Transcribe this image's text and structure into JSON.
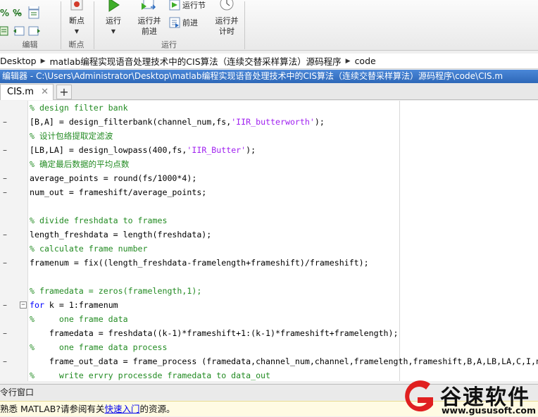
{
  "ribbon": {
    "groups": [
      {
        "label": "编辑"
      },
      {
        "label": "断点"
      },
      {
        "label": "运行"
      }
    ],
    "breakpoints_button": {
      "label": "断点"
    },
    "run_button": {
      "label": "运行"
    },
    "run_advance_button": {
      "label": "运行并\n前进"
    },
    "run_section_button": {
      "label": "运行节"
    },
    "advance_button": {
      "label": "前进"
    },
    "run_time_button": {
      "label": "运行并\n计时"
    }
  },
  "address": {
    "parts": [
      "Desktop",
      "matlab编程实现语音处理技术中的CIS算法（连续交替采样算法）源码程序",
      "code"
    ]
  },
  "editor": {
    "title": "编辑器 - C:\\Users\\Administrator\\Desktop\\matlab编程实现语音处理技术中的CIS算法（连续交替采样算法）源码程序\\code\\CIS.m",
    "tab_label": "CIS.m",
    "tab_close": "✕",
    "add_tab": "+",
    "lines": [
      {
        "mark": "",
        "fold": "",
        "parts": [
          {
            "t": "% design filter bank",
            "c": "comment"
          }
        ]
      },
      {
        "mark": "–",
        "fold": "",
        "parts": [
          {
            "t": "[B,A] = design_filterbank(channel_num,fs,",
            "c": "code"
          },
          {
            "t": "'IIR_butterworth'",
            "c": "string"
          },
          {
            "t": ");",
            "c": "code"
          }
        ]
      },
      {
        "mark": "",
        "fold": "",
        "parts": [
          {
            "t": "% 设计包络提取定滤波",
            "c": "comment"
          }
        ]
      },
      {
        "mark": "–",
        "fold": "",
        "parts": [
          {
            "t": "[LB,LA] = design_lowpass(400,fs,",
            "c": "code"
          },
          {
            "t": "'IIR_Butter'",
            "c": "string"
          },
          {
            "t": ");",
            "c": "code"
          }
        ]
      },
      {
        "mark": "",
        "fold": "",
        "parts": [
          {
            "t": "% 确定最后数据的平均点数",
            "c": "comment"
          }
        ]
      },
      {
        "mark": "–",
        "fold": "",
        "parts": [
          {
            "t": "average_points = round(fs/1000*4);",
            "c": "code"
          }
        ]
      },
      {
        "mark": "–",
        "fold": "",
        "parts": [
          {
            "t": "num_out = frameshift/average_points;",
            "c": "code"
          }
        ]
      },
      {
        "mark": "",
        "fold": "",
        "parts": [
          {
            "t": "",
            "c": "code"
          }
        ]
      },
      {
        "mark": "",
        "fold": "",
        "parts": [
          {
            "t": "% divide freshdata to frames",
            "c": "comment"
          }
        ]
      },
      {
        "mark": "–",
        "fold": "",
        "parts": [
          {
            "t": "length_freshdata = length(freshdata);",
            "c": "code"
          }
        ]
      },
      {
        "mark": "",
        "fold": "",
        "parts": [
          {
            "t": "% calculate frame number",
            "c": "comment"
          }
        ]
      },
      {
        "mark": "–",
        "fold": "",
        "parts": [
          {
            "t": "framenum = fix((length_freshdata-framelength+frameshift)/frameshift);",
            "c": "code"
          }
        ]
      },
      {
        "mark": "",
        "fold": "",
        "parts": [
          {
            "t": "",
            "c": "code"
          }
        ]
      },
      {
        "mark": "",
        "fold": "",
        "parts": [
          {
            "t": "% framedata = zeros(framelength,1);",
            "c": "comment"
          }
        ]
      },
      {
        "mark": "–",
        "fold": "−",
        "parts": [
          {
            "t": "for",
            "c": "kw"
          },
          {
            "t": " k = 1:framenum",
            "c": "code"
          }
        ]
      },
      {
        "mark": "",
        "fold": "",
        "parts": [
          {
            "t": "%     one frame data",
            "c": "comment"
          }
        ]
      },
      {
        "mark": "–",
        "fold": "",
        "parts": [
          {
            "t": "    framedata = freshdata((k-1)*frameshift+1:(k-1)*frameshift+framelength);",
            "c": "code"
          }
        ]
      },
      {
        "mark": "",
        "fold": "",
        "parts": [
          {
            "t": "%     one frame data process",
            "c": "comment"
          }
        ]
      },
      {
        "mark": "–",
        "fold": "",
        "parts": [
          {
            "t": "    frame_out_data = frame_process (framedata,channel_num,channel,framelength,frameshift,B,A,LB,LA,C,I,n",
            "c": "code"
          }
        ]
      },
      {
        "mark": "",
        "fold": "",
        "parts": [
          {
            "t": "%     write ervry processde framedata to data_out",
            "c": "comment"
          }
        ]
      }
    ]
  },
  "command_window": {
    "title": "令行窗口",
    "info_prefix": "熟悉 MATLAB?请参阅有关",
    "info_link": "快速入门",
    "info_suffix": "的资源。"
  },
  "watermark": {
    "brand": "谷速软件",
    "url": "www.gususoft.com"
  },
  "colors": {
    "title_bar": "#2e68b8",
    "comment": "#228b22",
    "string": "#a020f0",
    "keyword": "#0000ff",
    "watermark_red": "#e02020"
  }
}
